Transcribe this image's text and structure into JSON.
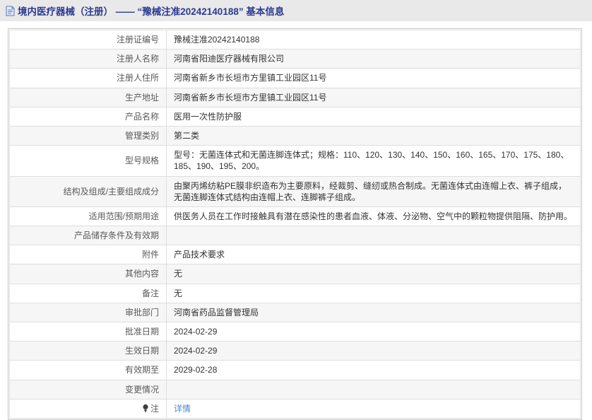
{
  "header": {
    "title": "境内医疗器械（注册） —— “豫械注准20242140188” 基本信息"
  },
  "table": {
    "rows": [
      {
        "label": "注册证编号",
        "value": "豫械注准20242140188"
      },
      {
        "label": "注册人名称",
        "value": "河南省阳迪医疗器械有限公司"
      },
      {
        "label": "注册人住所",
        "value": "河南省新乡市长垣市方里镇工业园区11号"
      },
      {
        "label": "生产地址",
        "value": "河南省新乡市长垣市方里镇工业园区11号"
      },
      {
        "label": "产品名称",
        "value": "医用一次性防护服"
      },
      {
        "label": "管理类别",
        "value": "第二类"
      },
      {
        "label": "型号规格",
        "value": "型号：无菌连体式和无菌连脚连体式；规格：110、120、130、140、150、160、165、170、175、180、185、190、195、200。"
      },
      {
        "label": "结构及组成/主要组成成分",
        "value": "由聚丙烯纺粘PE膜非织造布为主要原料，经裁剪、缝纫或热合制成。无菌连体式由连帽上衣、裤子组成，无菌连脚连体式结构由连帽上衣、连脚裤子组成。"
      },
      {
        "label": "适用范围/预期用途",
        "value": "供医务人员在工作时接触具有潜在感染性的患者血液、体液、分泌物、空气中的颗粒物提供阻隔、防护用。"
      },
      {
        "label": "产品储存条件及有效期",
        "value": ""
      },
      {
        "label": "附件",
        "value": "产品技术要求"
      },
      {
        "label": "其他内容",
        "value": "无"
      },
      {
        "label": "备注",
        "value": "无"
      },
      {
        "label": "审批部门",
        "value": "河南省药品监督管理局"
      },
      {
        "label": "批准日期",
        "value": "2024-02-29"
      },
      {
        "label": "生效日期",
        "value": "2024-02-29"
      },
      {
        "label": "有效期至",
        "value": "2029-02-28"
      },
      {
        "label": "变更情况",
        "value": ""
      },
      {
        "label": "注",
        "value": "详情",
        "value_is_link": true,
        "label_icon": "bulb-icon"
      }
    ]
  },
  "icons": {
    "title_icon": "document-icon",
    "note_icon": "bulb-icon"
  },
  "colors": {
    "title": "#2b3a92",
    "link": "#4a87c7",
    "band_bg": "#e9e9e9",
    "row_alt_bg": "#f6f6f6",
    "outer_border": "#c6c6c6",
    "cell_border": "#dedede"
  }
}
